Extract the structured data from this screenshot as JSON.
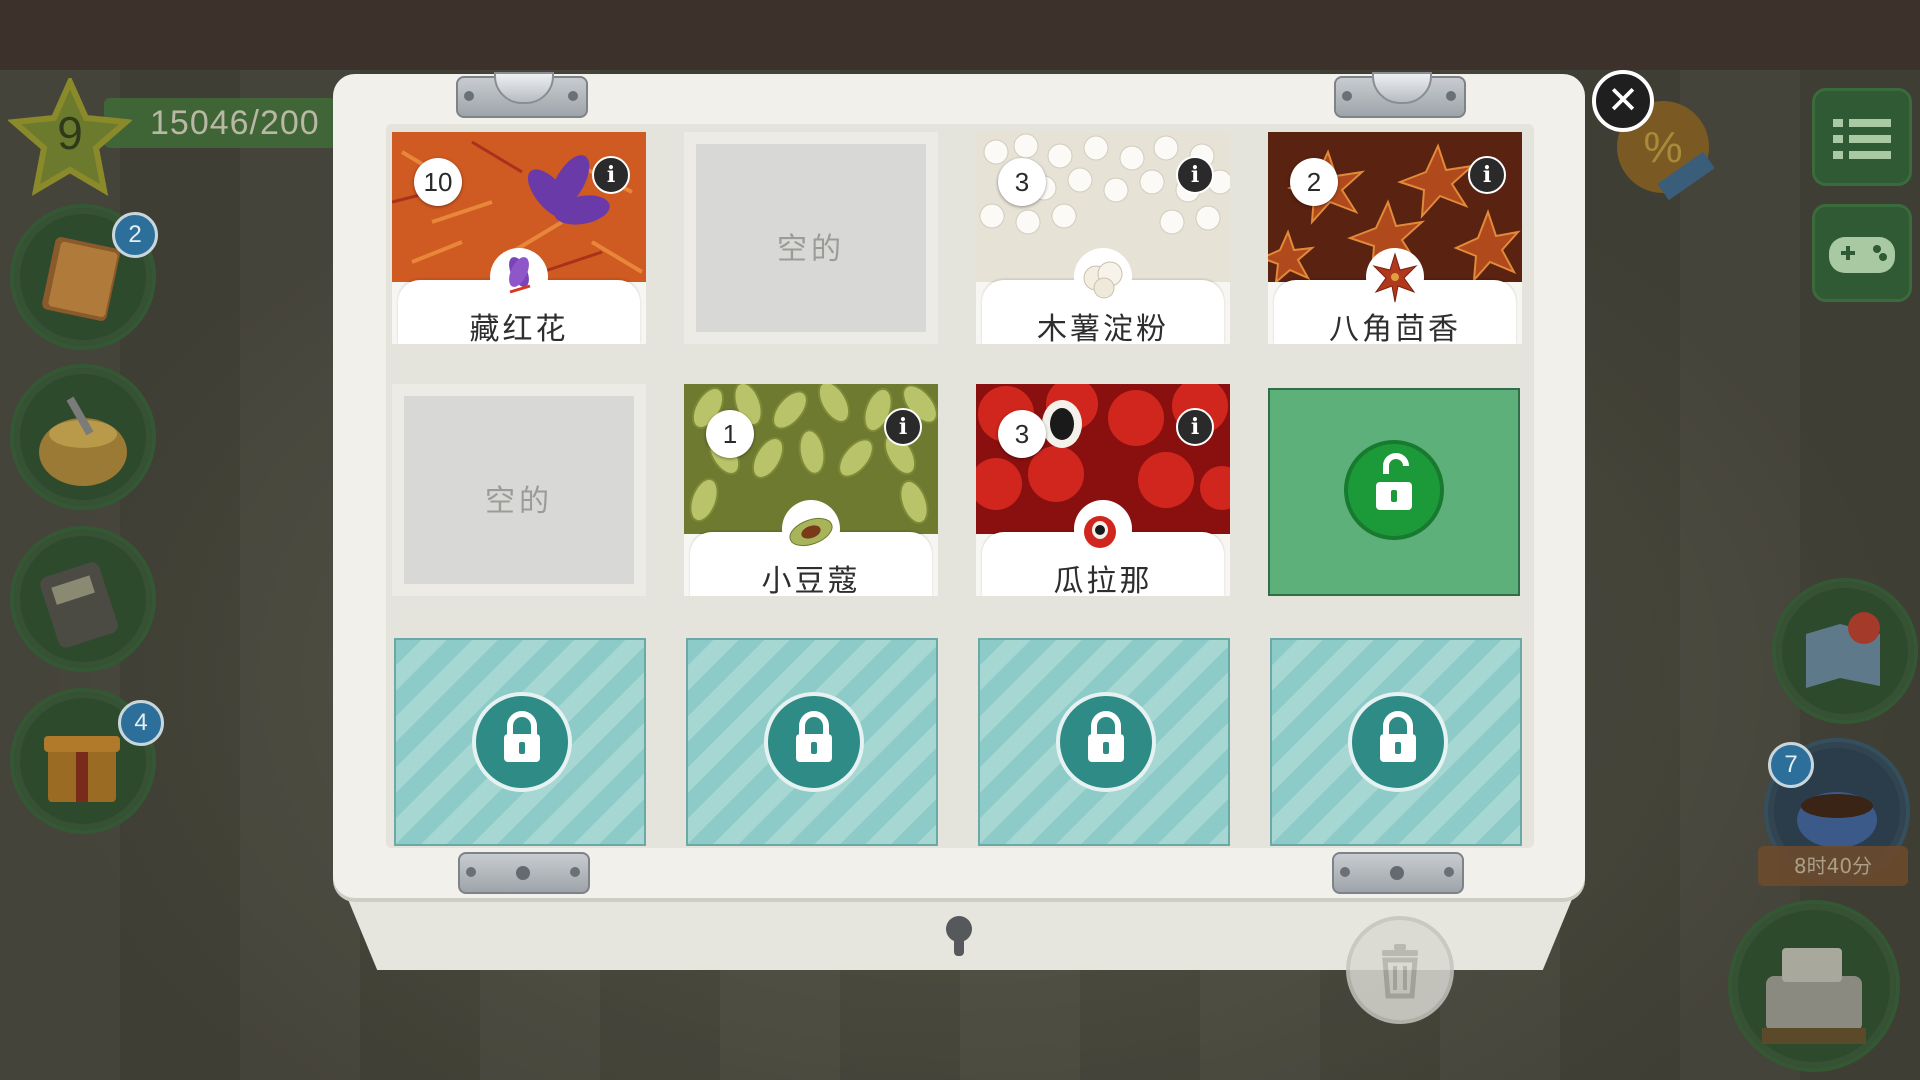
{
  "hud": {
    "level": "9",
    "xp": "15046/200",
    "badges": {
      "book": "2",
      "gift": "4",
      "coffee": "7"
    },
    "timer": "8时40分"
  },
  "colors": {
    "chest": "#f1f0ea",
    "unlock_green": "#5db07a",
    "locked_teal": "#8ccbc7",
    "lock_icon_bg": "#2e8b86"
  },
  "slots": [
    {
      "state": "item",
      "name": "藏红花",
      "qty": "10",
      "icon": "saffron-icon",
      "art": "#d9541e"
    },
    {
      "state": "empty",
      "label": "空的"
    },
    {
      "state": "item",
      "name": "木薯淀粉",
      "qty": "3",
      "icon": "tapioca-icon",
      "art": "#ece8df"
    },
    {
      "state": "item",
      "name": "八角茴香",
      "qty": "2",
      "icon": "star-anise-icon",
      "art": "#a0401a"
    },
    {
      "state": "empty",
      "label": "空的"
    },
    {
      "state": "item",
      "name": "小豆蔻",
      "qty": "1",
      "icon": "cardamom-icon",
      "art": "#a9b55a"
    },
    {
      "state": "item",
      "name": "瓜拉那",
      "qty": "3",
      "icon": "guarana-icon",
      "art": "#c9211f"
    },
    {
      "state": "unlockable",
      "icon": "unlock-icon"
    },
    {
      "state": "locked",
      "icon": "lock-icon"
    },
    {
      "state": "locked",
      "icon": "lock-icon"
    },
    {
      "state": "locked",
      "icon": "lock-icon"
    },
    {
      "state": "locked",
      "icon": "lock-icon"
    }
  ]
}
